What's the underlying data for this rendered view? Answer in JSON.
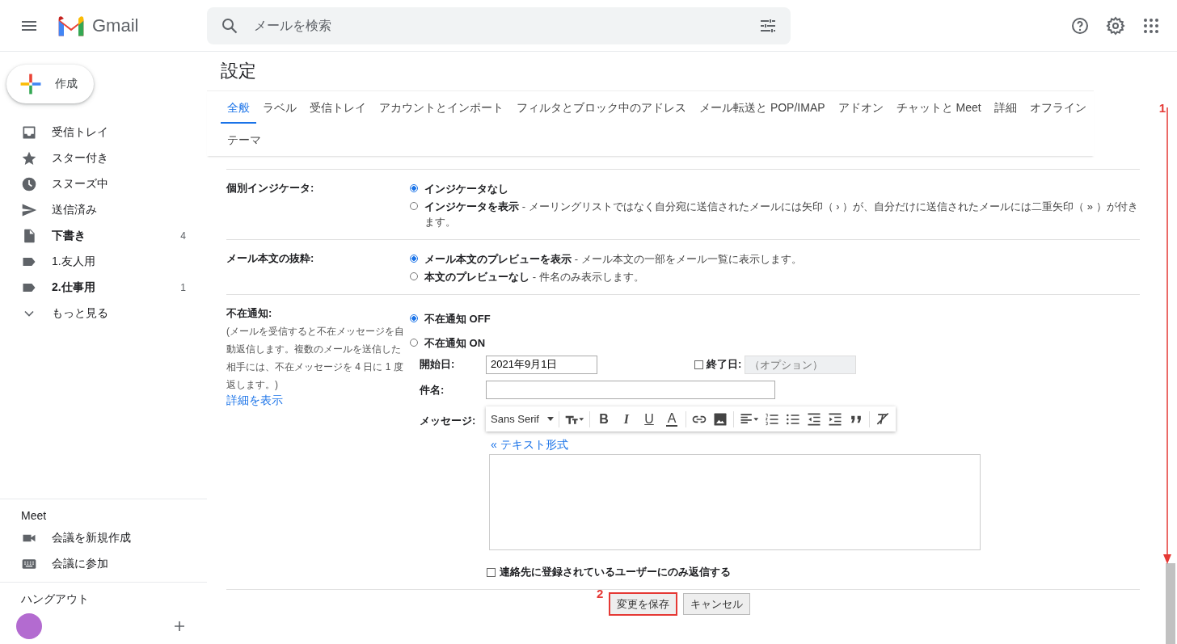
{
  "header": {
    "app_name": "Gmail",
    "search": {
      "placeholder": "メールを検索"
    }
  },
  "sidebar": {
    "compose": "作成",
    "items": [
      {
        "label": "受信トレイ",
        "unread": false
      },
      {
        "label": "スター付き",
        "unread": false
      },
      {
        "label": "スヌーズ中",
        "unread": false
      },
      {
        "label": "送信済み",
        "unread": false
      },
      {
        "label": "下書き",
        "count": "4",
        "unread": true
      },
      {
        "label": "1.友人用",
        "unread": false
      },
      {
        "label": "2.仕事用",
        "count": "1",
        "unread": true
      },
      {
        "label": "もっと見る",
        "unread": false
      }
    ],
    "meet": {
      "title": "Meet",
      "items": [
        "会議を新規作成",
        "会議に参加"
      ]
    },
    "hangouts": {
      "title": "ハングアウト"
    }
  },
  "settings": {
    "title": "設定",
    "tabs": [
      {
        "label": "全般",
        "selected": true
      },
      {
        "label": "ラベル",
        "selected": false
      },
      {
        "label": "受信トレイ",
        "selected": false
      },
      {
        "label": "アカウントとインポート",
        "selected": false
      },
      {
        "label": "フィルタとブロック中のアドレス",
        "selected": false
      },
      {
        "label": "メール転送と POP/IMAP",
        "selected": false
      },
      {
        "label": "アドオン",
        "selected": false
      },
      {
        "label": "チャットと Meet",
        "selected": false
      },
      {
        "label": "詳細",
        "selected": false
      },
      {
        "label": "オフライン",
        "selected": false
      },
      {
        "label": "テーマ",
        "selected": false
      }
    ],
    "sections": [
      {
        "label": "個別インジケータ:",
        "options": [
          {
            "title": "インジケータなし",
            "selected": true
          },
          {
            "title": "インジケータを表示",
            "description": "- メーリングリストではなく自分宛に送信されたメールには矢印（ › ）が、自分だけに送信されたメールには二重矢印（ » ）が付きます。",
            "selected": false
          }
        ]
      },
      {
        "label": "メール本文の抜粋:",
        "options": [
          {
            "title": "メール本文のプレビューを表示",
            "description": "- メール本文の一部をメール一覧に表示します。",
            "selected": true
          },
          {
            "title": "本文のプレビューなし",
            "description": "- 件名のみ表示します。",
            "selected": false
          }
        ]
      }
    ],
    "vacation": {
      "label": "不在通知:",
      "note": "(メールを受信すると不在メッセージを自動返信します。複数のメールを送信した相手には、不在メッセージを 4 日に 1 度返します。)",
      "link": "詳細を表示",
      "options": [
        {
          "title": "不在通知 OFF",
          "selected": true
        },
        {
          "title": "不在通知 ON",
          "selected": false
        }
      ],
      "start_date": {
        "label": "開始日:",
        "value": "2021年9月1日"
      },
      "end_date": {
        "label": "終了日:",
        "checked": false,
        "placeholder": "（オプション）"
      },
      "subject": {
        "label": "件名:"
      },
      "message": {
        "label": "メッセージ:",
        "font": "Sans Serif",
        "letters": [
          "B",
          "I",
          "U",
          "A"
        ],
        "plain_text_link": "« テキスト形式"
      },
      "contacts_only": {
        "label": "連絡先に登録されているユーザーにのみ返信する",
        "checked": false
      }
    },
    "buttons": [
      {
        "label": "変更を保存",
        "highlighted": true
      },
      {
        "label": "キャンセル",
        "highlighted": false
      }
    ]
  },
  "annotations": [
    {
      "label": "1"
    },
    {
      "label": "2"
    }
  ]
}
